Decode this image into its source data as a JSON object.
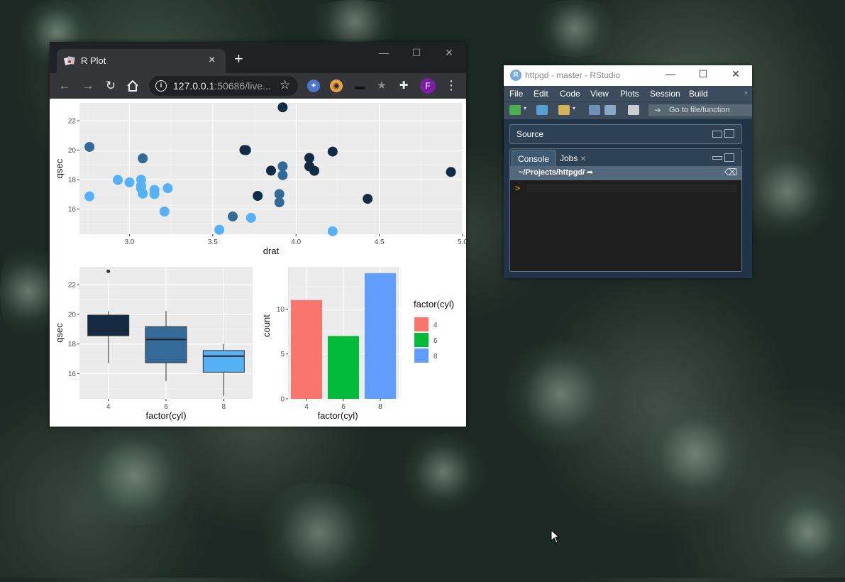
{
  "chrome": {
    "tab_title": "R Plot",
    "tab_close": "×",
    "new_tab": "+",
    "url_host": "127.0.0.1",
    "url_rest": ":50686/live...",
    "profile_initial": "F"
  },
  "rstudio": {
    "window_title": "httpgd - master - RStudio",
    "menu": [
      "File",
      "Edit",
      "Code",
      "View",
      "Plots",
      "Session",
      "Build"
    ],
    "goto_placeholder": "Go to file/function",
    "source_label": "Source",
    "tabs": [
      "Console",
      "Jobs"
    ],
    "console_path": "~/Projects/httpgd/",
    "prompt": ">"
  },
  "chart_data": [
    {
      "type": "scatter",
      "xlabel": "drat",
      "ylabel": "qsec",
      "xlim": [
        2.7,
        5.0
      ],
      "ylim": [
        14.3,
        23.2
      ],
      "xticks": [
        "3.0",
        "3.5",
        "4.0",
        "4.5",
        "5.0"
      ],
      "yticks": [
        "16",
        "18",
        "20",
        "22"
      ],
      "points": [
        {
          "x": 2.76,
          "y": 20.22,
          "c": "#336a98"
        },
        {
          "x": 2.76,
          "y": 16.87,
          "c": "#56b1f7"
        },
        {
          "x": 2.93,
          "y": 17.98,
          "c": "#56b1f7"
        },
        {
          "x": 3.0,
          "y": 17.82,
          "c": "#56b1f7"
        },
        {
          "x": 3.07,
          "y": 17.4,
          "c": "#56b1f7"
        },
        {
          "x": 3.07,
          "y": 17.6,
          "c": "#56b1f7"
        },
        {
          "x": 3.07,
          "y": 18.0,
          "c": "#56b1f7"
        },
        {
          "x": 3.08,
          "y": 19.44,
          "c": "#336a98"
        },
        {
          "x": 3.08,
          "y": 17.05,
          "c": "#56b1f7"
        },
        {
          "x": 3.15,
          "y": 17.02,
          "c": "#56b1f7"
        },
        {
          "x": 3.15,
          "y": 17.3,
          "c": "#56b1f7"
        },
        {
          "x": 3.21,
          "y": 15.84,
          "c": "#56b1f7"
        },
        {
          "x": 3.23,
          "y": 17.42,
          "c": "#56b1f7"
        },
        {
          "x": 3.54,
          "y": 14.6,
          "c": "#56b1f7"
        },
        {
          "x": 3.62,
          "y": 15.5,
          "c": "#336a98"
        },
        {
          "x": 3.69,
          "y": 20.01,
          "c": "#132b43"
        },
        {
          "x": 3.7,
          "y": 20.0,
          "c": "#132b43"
        },
        {
          "x": 3.73,
          "y": 15.41,
          "c": "#56b1f7"
        },
        {
          "x": 3.77,
          "y": 16.9,
          "c": "#132b43"
        },
        {
          "x": 3.85,
          "y": 18.61,
          "c": "#132b43"
        },
        {
          "x": 3.9,
          "y": 16.46,
          "c": "#336a98"
        },
        {
          "x": 3.9,
          "y": 17.02,
          "c": "#336a98"
        },
        {
          "x": 3.92,
          "y": 22.9,
          "c": "#132b43"
        },
        {
          "x": 3.92,
          "y": 18.9,
          "c": "#336a98"
        },
        {
          "x": 3.92,
          "y": 18.3,
          "c": "#336a98"
        },
        {
          "x": 4.08,
          "y": 19.47,
          "c": "#132b43"
        },
        {
          "x": 4.08,
          "y": 18.9,
          "c": "#132b43"
        },
        {
          "x": 4.11,
          "y": 18.6,
          "c": "#132b43"
        },
        {
          "x": 4.22,
          "y": 19.9,
          "c": "#132b43"
        },
        {
          "x": 4.22,
          "y": 14.5,
          "c": "#56b1f7"
        },
        {
          "x": 4.43,
          "y": 16.7,
          "c": "#132b43"
        },
        {
          "x": 4.93,
          "y": 18.52,
          "c": "#132b43"
        }
      ]
    },
    {
      "type": "box",
      "xlabel": "factor(cyl)",
      "ylabel": "qsec",
      "ylim": [
        14.3,
        23.2
      ],
      "yticks": [
        "16",
        "18",
        "20",
        "22"
      ],
      "categories": [
        "4",
        "6",
        "8"
      ],
      "boxes": [
        {
          "min": 16.7,
          "q1": 18.56,
          "median": 18.9,
          "q3": 19.95,
          "max": 20.22,
          "outliers": [
            22.9
          ],
          "fill": "#132b43"
        },
        {
          "min": 15.5,
          "q1": 16.74,
          "median": 18.3,
          "q3": 19.17,
          "max": 20.22,
          "outliers": [],
          "fill": "#336a98"
        },
        {
          "min": 14.5,
          "q1": 16.1,
          "median": 17.18,
          "q3": 17.56,
          "max": 18.0,
          "outliers": [],
          "fill": "#56b1f7"
        }
      ]
    },
    {
      "type": "bar",
      "xlabel": "factor(cyl)",
      "ylabel": "count",
      "ylim": [
        0,
        14.7
      ],
      "yticks": [
        "0",
        "5",
        "10"
      ],
      "categories": [
        "4",
        "6",
        "8"
      ],
      "values": [
        11,
        7,
        14
      ],
      "colors": [
        "#f8766d",
        "#00ba38",
        "#619cff"
      ],
      "legend_title": "factor(cyl)",
      "legend_labels": [
        "4",
        "6",
        "8"
      ]
    }
  ]
}
